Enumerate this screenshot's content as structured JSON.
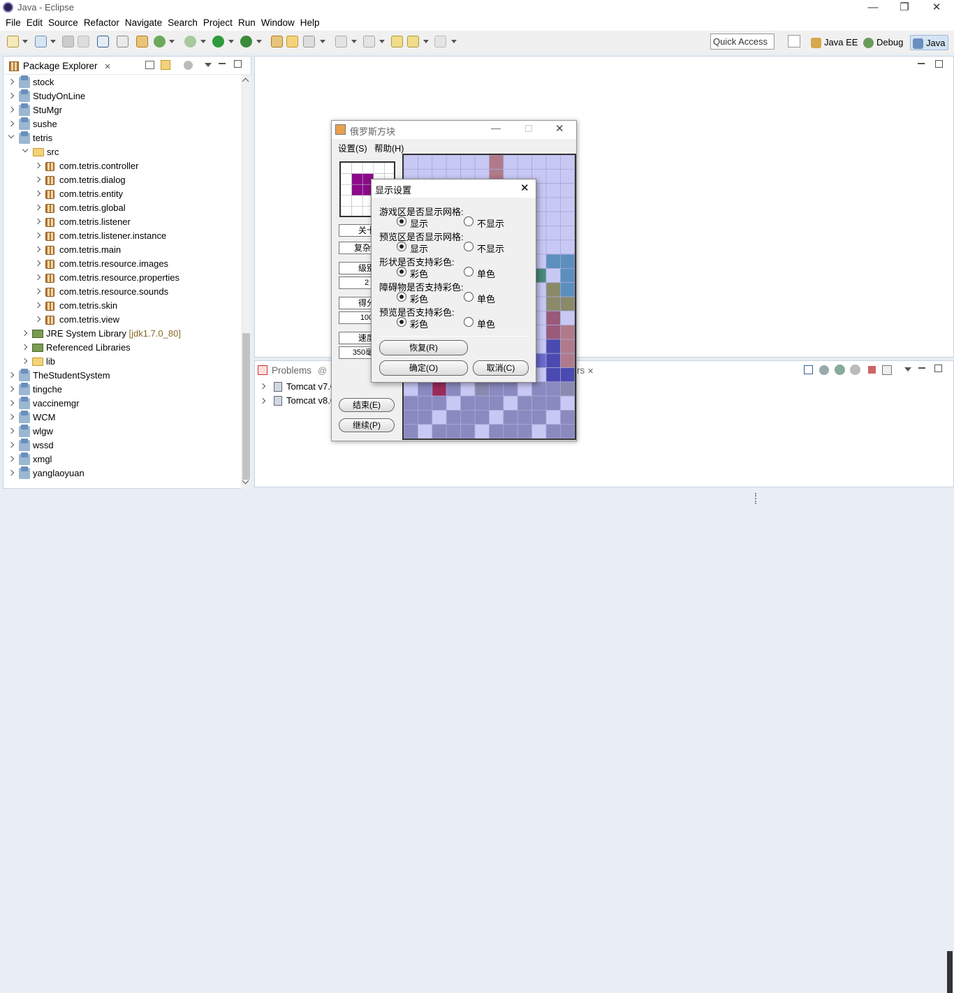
{
  "window": {
    "title": "Java - Eclipse",
    "minimize": "—",
    "restore": "❐",
    "close": "✕"
  },
  "menu": [
    "File",
    "Edit",
    "Source",
    "Refactor",
    "Navigate",
    "Search",
    "Project",
    "Run",
    "Window",
    "Help"
  ],
  "quick_access": "Quick Access",
  "perspectives": [
    {
      "label": "Java EE",
      "icon": "java-ee-perspective-icon"
    },
    {
      "label": "Debug",
      "icon": "debug-perspective-icon"
    },
    {
      "label": "Java",
      "icon": "java-perspective-icon"
    }
  ],
  "package_explorer": {
    "tab_label": "Package Explorer",
    "items": [
      {
        "label": "stock",
        "type": "project",
        "expanded": false
      },
      {
        "label": "StudyOnLine",
        "type": "project",
        "expanded": false
      },
      {
        "label": "StuMgr",
        "type": "project",
        "expanded": false
      },
      {
        "label": "sushe",
        "type": "project",
        "expanded": false
      },
      {
        "label": "tetris",
        "type": "project",
        "expanded": true
      },
      {
        "label": "src",
        "type": "srcfolder",
        "expanded": true
      },
      {
        "label": "com.tetris.controller",
        "type": "package"
      },
      {
        "label": "com.tetris.dialog",
        "type": "package"
      },
      {
        "label": "com.tetris.entity",
        "type": "package"
      },
      {
        "label": "com.tetris.global",
        "type": "package"
      },
      {
        "label": "com.tetris.listener",
        "type": "package"
      },
      {
        "label": "com.tetris.listener.instance",
        "type": "package"
      },
      {
        "label": "com.tetris.main",
        "type": "package"
      },
      {
        "label": "com.tetris.resource.images",
        "type": "package"
      },
      {
        "label": "com.tetris.resource.properties",
        "type": "package"
      },
      {
        "label": "com.tetris.resource.sounds",
        "type": "package"
      },
      {
        "label": "com.tetris.skin",
        "type": "package"
      },
      {
        "label": "com.tetris.view",
        "type": "package"
      },
      {
        "label": "JRE System Library",
        "suffix": "[jdk1.7.0_80]",
        "type": "library"
      },
      {
        "label": "Referenced Libraries",
        "type": "library"
      },
      {
        "label": "lib",
        "type": "folder"
      },
      {
        "label": "TheStudentSystem",
        "type": "project"
      },
      {
        "label": "tingche",
        "type": "project"
      },
      {
        "label": "vaccinemgr",
        "type": "project"
      },
      {
        "label": "WCM",
        "type": "project"
      },
      {
        "label": "wlgw",
        "type": "project"
      },
      {
        "label": "wssd",
        "type": "project"
      },
      {
        "label": "xmgl",
        "type": "project"
      },
      {
        "label": "yanglaoyuan",
        "type": "project"
      }
    ]
  },
  "bottom": {
    "tab_problems": "Problems",
    "tab_servers_tail": "rs",
    "servers": [
      "Tomcat v7.0",
      "Tomcat v8.0"
    ]
  },
  "tetris": {
    "title": "俄罗斯方块",
    "menu": [
      "设置(S)",
      "帮助(H)"
    ],
    "side_buttons": [
      "关卡",
      "复杂性",
      "级别",
      "得分",
      "速度"
    ],
    "level_value": "2",
    "score_value": "100",
    "speed_value": "350毫秒",
    "end_button": "结束(E)",
    "continue_button": "继续(P)"
  },
  "dialog": {
    "title": "显示设置",
    "close": "✕",
    "groups": [
      {
        "question": "游戏区是否显示网格:",
        "opt_a": "显示",
        "opt_b": "不显示",
        "selected": "a"
      },
      {
        "question": "预览区是否显示网格:",
        "opt_a": "显示",
        "opt_b": "不显示",
        "selected": "a"
      },
      {
        "question": "形状是否支持彩色:",
        "opt_a": "彩色",
        "opt_b": "单色",
        "selected": "a"
      },
      {
        "question": "障碍物是否支持彩色:",
        "opt_a": "彩色",
        "opt_b": "单色",
        "selected": "a"
      },
      {
        "question": "预览是否支持彩色:",
        "opt_a": "彩色",
        "opt_b": "单色",
        "selected": "a"
      }
    ],
    "restore_button": "恢复(R)",
    "ok_button": "确定(O)",
    "cancel_button": "取消(C)"
  }
}
